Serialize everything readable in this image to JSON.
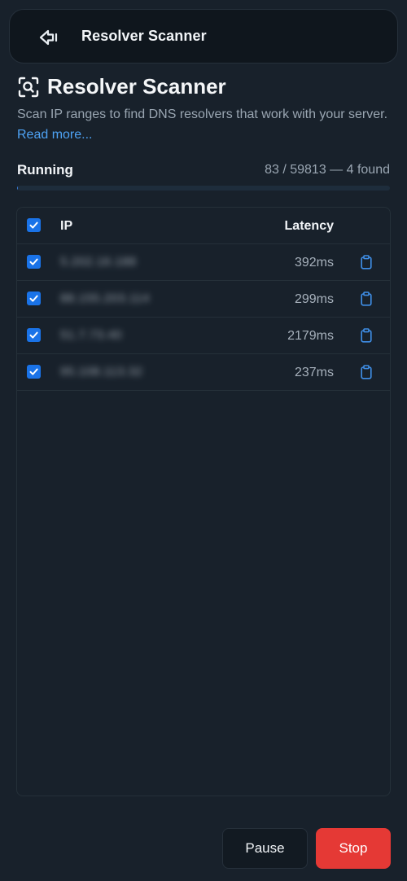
{
  "header": {
    "back_icon": "back-arrow-icon",
    "title": "Resolver Scanner"
  },
  "page": {
    "title": "Resolver Scanner",
    "title_icon": "scan-search-icon",
    "description": "Scan IP ranges to find DNS resolvers that work with your server.",
    "read_more": "Read more..."
  },
  "status": {
    "label": "Running",
    "count": "83 / 59813 — 4 found",
    "scanned": 83,
    "total": 59813,
    "found": 4,
    "progress_fraction": 0.0014
  },
  "table": {
    "header_checked": true,
    "columns": {
      "ip": "IP",
      "latency": "Latency"
    },
    "rows": [
      {
        "ip": "5.202.16.188",
        "latency": "392ms",
        "checked": true
      },
      {
        "ip": "88.155.203.114",
        "latency": "299ms",
        "checked": true
      },
      {
        "ip": "51.7.73.40",
        "latency": "2179ms",
        "checked": true
      },
      {
        "ip": "95.108.113.32",
        "latency": "237ms",
        "checked": true
      }
    ],
    "copy_icon": "clipboard-icon"
  },
  "actions": {
    "pause": "Pause",
    "stop": "Stop"
  },
  "colors": {
    "background": "#18212b",
    "accent": "#1a73e8",
    "link": "#4ea3f5",
    "stop": "#e53935"
  }
}
